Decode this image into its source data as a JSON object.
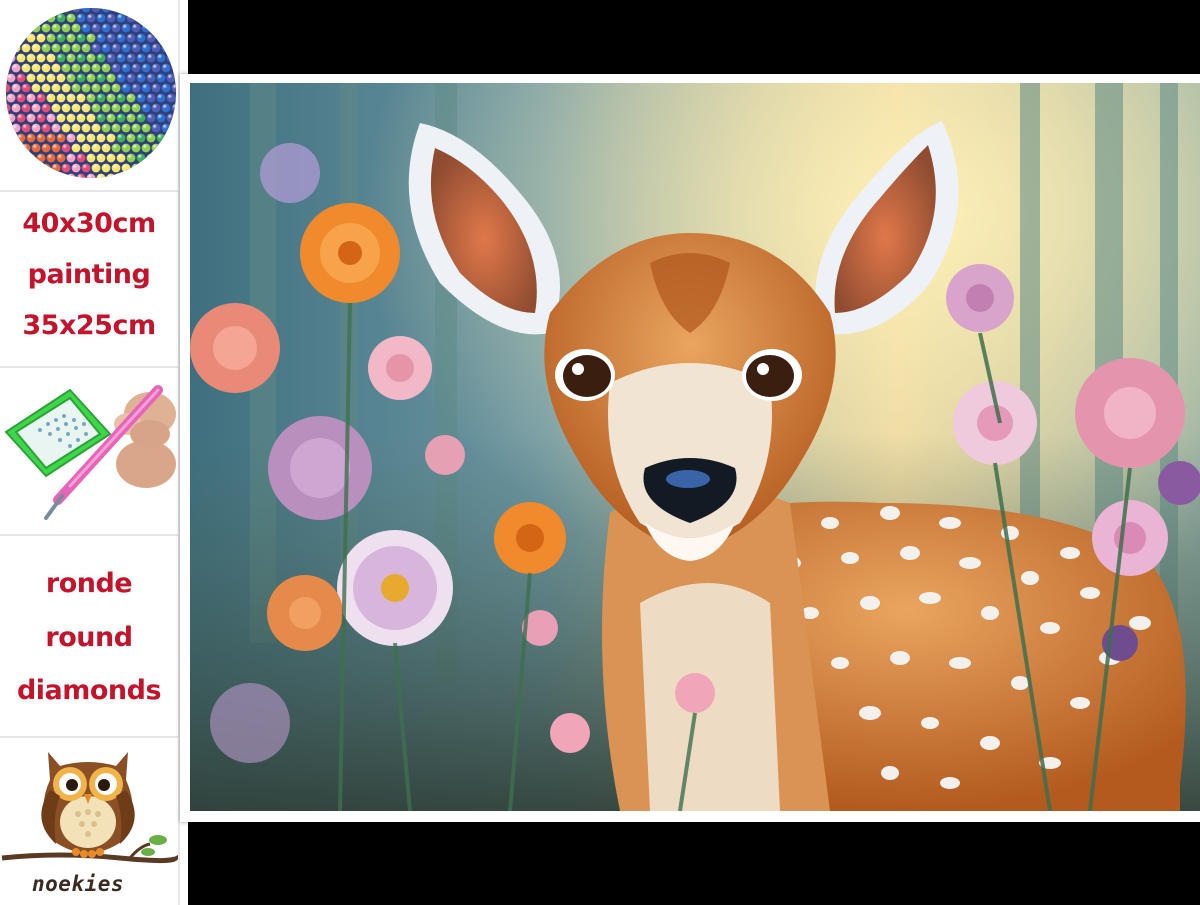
{
  "sidebar": {
    "size_lines": [
      "40x30cm",
      "painting",
      "35x25cm"
    ],
    "diamond_lines": [
      "ronde",
      "round",
      "diamonds"
    ],
    "brand": "noekies"
  },
  "colors": {
    "label_red": "#c4142c",
    "band_black": "#000000",
    "fawn_orange": "#c8682a"
  },
  "icons": {
    "diamond_closeup": "diamond-beads-closeup-icon",
    "applicator": "diamond-pen-tray-icon",
    "logo": "owl-logo-icon"
  }
}
